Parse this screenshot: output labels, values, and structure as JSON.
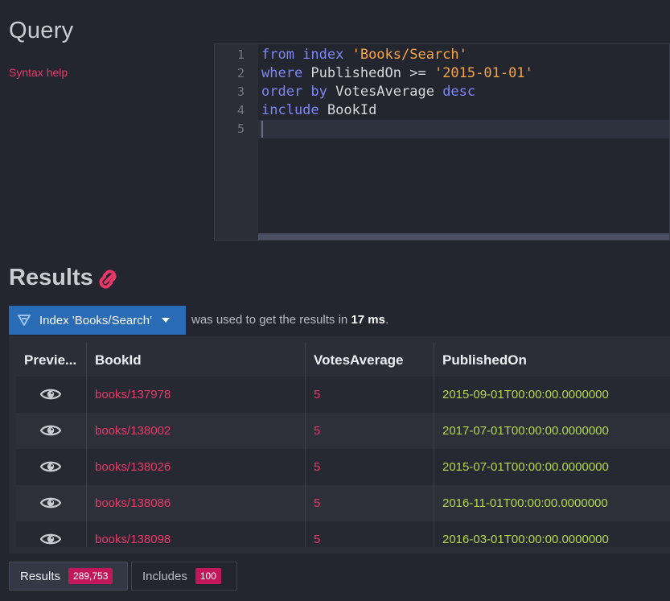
{
  "query": {
    "title": "Query",
    "syntax_help": "Syntax help",
    "lines": [
      {
        "num": "1",
        "parts": [
          {
            "t": "from index ",
            "c": "kw"
          },
          {
            "t": "'Books/Search'",
            "c": "str"
          }
        ]
      },
      {
        "num": "2",
        "parts": [
          {
            "t": "where ",
            "c": "kw"
          },
          {
            "t": "PublishedOn >= ",
            "c": ""
          },
          {
            "t": "'2015-01-01'",
            "c": "str"
          }
        ]
      },
      {
        "num": "3",
        "parts": [
          {
            "t": "order by ",
            "c": "kw"
          },
          {
            "t": "VotesAverage ",
            "c": ""
          },
          {
            "t": "desc",
            "c": "kw"
          }
        ]
      },
      {
        "num": "4",
        "parts": [
          {
            "t": "include ",
            "c": "kw"
          },
          {
            "t": "BookId",
            "c": ""
          }
        ]
      },
      {
        "num": "5",
        "parts": []
      }
    ]
  },
  "results": {
    "title": "Results",
    "index_button": "Index 'Books/Search'",
    "used_text_before": "was used to get the results in ",
    "duration": "17 ms",
    "used_text_after": ".",
    "columns": [
      "Previe...",
      "BookId",
      "VotesAverage",
      "PublishedOn"
    ],
    "rows": [
      {
        "book": "books/137978",
        "votes": "5",
        "published": "2015-09-01T00:00:00.0000000"
      },
      {
        "book": "books/138002",
        "votes": "5",
        "published": "2017-07-01T00:00:00.0000000"
      },
      {
        "book": "books/138026",
        "votes": "5",
        "published": "2015-07-01T00:00:00.0000000"
      },
      {
        "book": "books/138086",
        "votes": "5",
        "published": "2016-11-01T00:00:00.0000000"
      },
      {
        "book": "books/138098",
        "votes": "5",
        "published": "2016-03-01T00:00:00.0000000"
      }
    ]
  },
  "tabs": {
    "results_label": "Results",
    "results_count": "289,753",
    "includes_label": "Includes",
    "includes_count": "100"
  },
  "icons": {
    "link": "link-icon",
    "index": "index-icon",
    "preview": "eye-icon"
  },
  "colors": {
    "accent": "#e8386a",
    "primary": "#2a6bb5",
    "date": "#b4d84a",
    "keyword": "#7c87f5",
    "string": "#f7a542"
  }
}
